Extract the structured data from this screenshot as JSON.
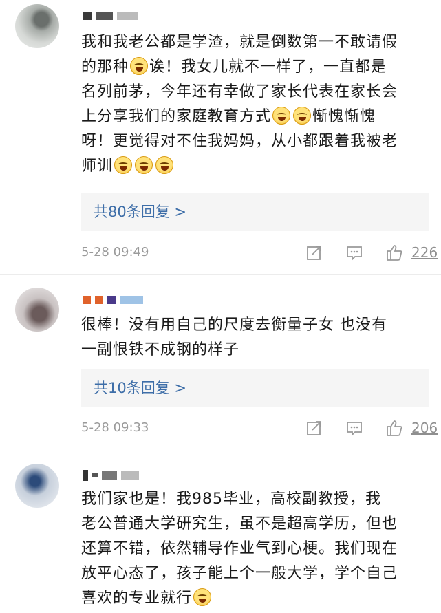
{
  "comments": [
    {
      "text_line1": "我和我老公都是学渣，就是倒数第一不敢请假",
      "text_line2a": "的那种",
      "text_line2b": "诶！我女儿就不一样了，一直都是",
      "text_line3": "名列前茅，今年还有幸做了家长代表在家长会",
      "text_line4a": "上分享我们的家庭教育方式",
      "text_line4b": "惭愧惭愧",
      "text_line5": "呀！更觉得对不住我妈妈，从小都跟着我被老",
      "text_line6": "师训",
      "replies": "共80条回复 >",
      "time": "5-28 09:49",
      "likes": "226"
    },
    {
      "text_line1": "很棒！没有用自己的尺度去衡量子女 也没有",
      "text_line2": "一副恨铁不成钢的样子",
      "replies": "共10条回复 >",
      "time": "5-28 09:33",
      "likes": "206"
    },
    {
      "text_line1": "我们家也是！我985毕业，高校副教授，我",
      "text_line2": "老公普通大学研究生，虽不是超高学历，但也",
      "text_line3": "还算不错，依然辅导作业气到心梗。我们现在",
      "text_line4": "放平心态了，孩子能上个一般大学，学个自己",
      "text_line5": "喜欢的专业就行"
    }
  ],
  "icons": {
    "share": "share-icon",
    "comment": "comment-icon",
    "like": "thumbs-up-icon",
    "emoji": "laughing-crying-emoji"
  },
  "colors": {
    "reply_link": "#3e6ea8",
    "meta_gray": "#9a9a9a",
    "reply_bg": "#f5f5f5"
  }
}
